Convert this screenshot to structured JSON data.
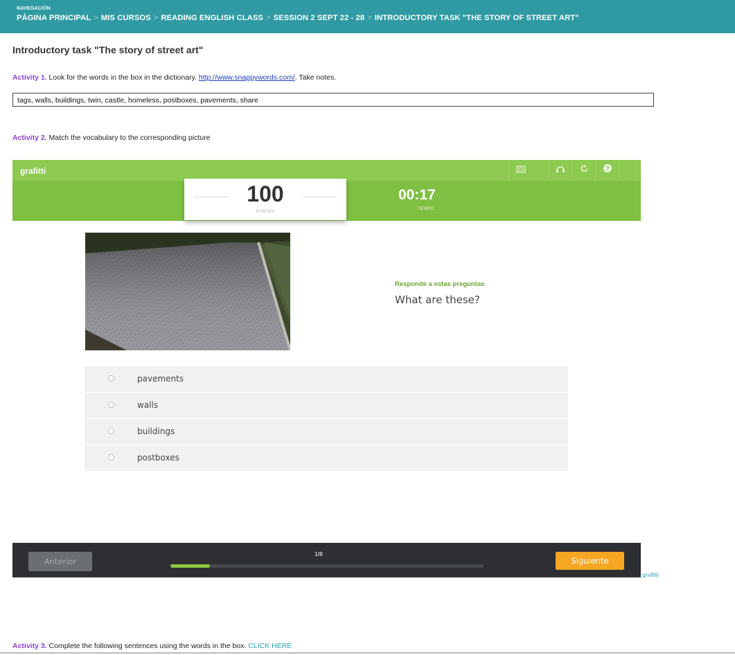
{
  "nav": {
    "label": "NAVEGACIÓN",
    "crumbs": [
      "PÁGINA PRINCIPAL",
      "MIS CURSOS",
      "READING ENGLISH CLASS",
      "SESSION 2 SEPT 22 - 28",
      "INTRODUCTORY TASK \"THE STORY OF STREET ART\""
    ],
    "separator": ">"
  },
  "page_title": "Introductory task \"The story of street art\"",
  "activity1": {
    "label": "Activity 1.",
    "text": " Look for the words in the box in the dictionary. ",
    "link": "http://www.snappywords.com/",
    "tail": ". Take notes.",
    "words": "tags, walls, buildings, twin, castle, homeless, postboxes, pavements, share"
  },
  "activity2": {
    "label": "Activity 2.",
    "text": " Match the vocabulary to the corresponding picture"
  },
  "quiz": {
    "title": "grafitti",
    "score": "100",
    "score_caption": "PUNTOS",
    "time": "00:17",
    "time_caption": "TIEMPO",
    "prompt": "Responde a estas preguntas",
    "question": "What are these?",
    "options": [
      "pavements",
      "walls",
      "buildings",
      "postboxes"
    ],
    "prev_label": "Anterior",
    "next_label": "Siguiente",
    "counter": "1/8",
    "progress": 0.125,
    "credit": "grafitti",
    "accent": "#8dca50",
    "next_color": "#f5a623"
  },
  "activity3": {
    "label": "Activity 3.",
    "text": " Complete the following sentences using the words in the box. ",
    "cta": "CLICK HERE"
  }
}
